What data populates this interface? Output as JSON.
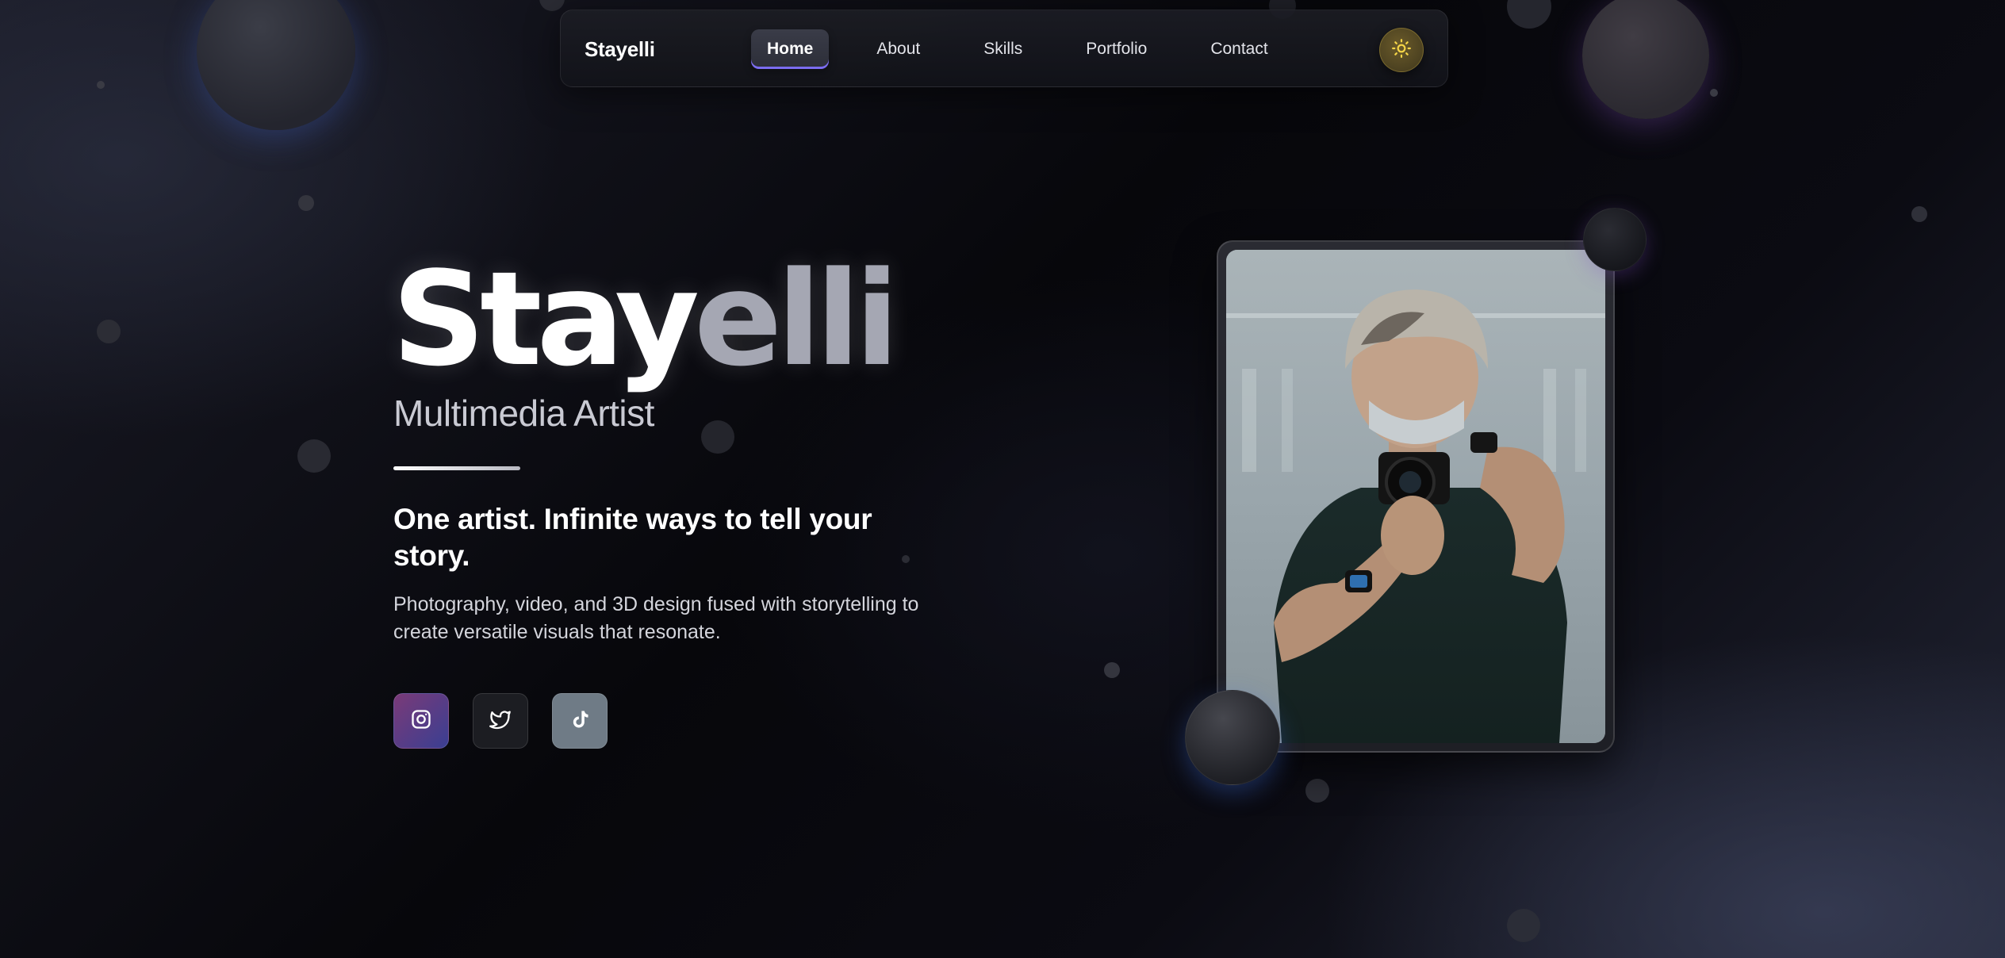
{
  "nav": {
    "brand": "Stayelli",
    "links": [
      {
        "label": "Home",
        "active": true
      },
      {
        "label": "About",
        "active": false
      },
      {
        "label": "Skills",
        "active": false
      },
      {
        "label": "Portfolio",
        "active": false
      },
      {
        "label": "Contact",
        "active": false
      }
    ],
    "theme_toggle_icon": "sun-icon"
  },
  "hero": {
    "name_part1": "Stay",
    "name_part2": "elli",
    "role": "Multimedia Artist",
    "tagline": "One artist. Infinite ways to tell your story.",
    "description": "Photography, video, and 3D design fused with storytelling to create versatile visuals that resonate."
  },
  "social": [
    {
      "icon": "instagram-icon",
      "color": "#5e3a86"
    },
    {
      "icon": "twitter-icon",
      "color": "#1c1d22"
    },
    {
      "icon": "tiktok-icon",
      "color": "#6f7b86"
    }
  ],
  "colors": {
    "accent": "#7b6cf0",
    "name_secondary": "#a5a7b3",
    "theme_button": "#4a4020"
  }
}
